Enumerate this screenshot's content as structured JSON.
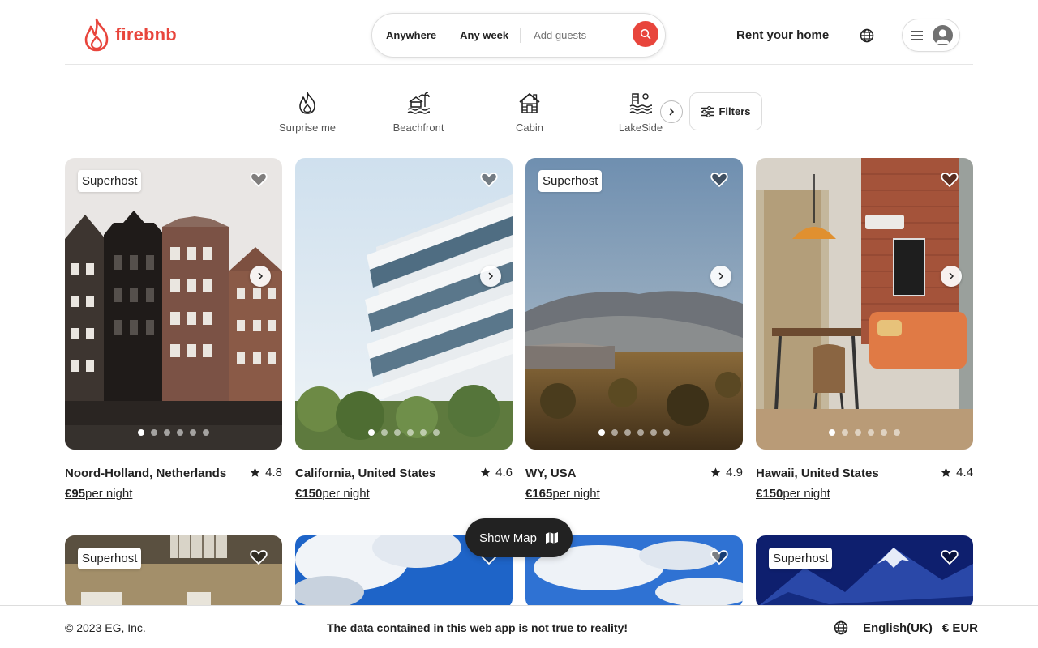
{
  "header": {
    "logo_text": "firebnb",
    "search": {
      "anywhere": "Anywhere",
      "any_week": "Any week",
      "add_guests": "Add guests"
    },
    "rent_label": "Rent your home"
  },
  "categories": [
    {
      "label": "Surprise me",
      "icon": "flame-icon"
    },
    {
      "label": "Beachfront",
      "icon": "beach-house-icon"
    },
    {
      "label": "Cabin",
      "icon": "cabin-icon"
    },
    {
      "label": "LakeSide",
      "icon": "lakeside-icon"
    }
  ],
  "filters_label": "Filters",
  "listings": [
    {
      "superhost": "Superhost",
      "location": "Noord-Holland, Netherlands",
      "rating": "4.8",
      "price": "€95",
      "per_night": "per night",
      "photo_count": 6,
      "active_photo": 0
    },
    {
      "superhost": "",
      "location": "California, United States",
      "rating": "4.6",
      "price": "€150",
      "per_night": "per night",
      "photo_count": 6,
      "active_photo": 0
    },
    {
      "superhost": "Superhost",
      "location": "WY, USA",
      "rating": "4.9",
      "price": "€165",
      "per_night": "per night",
      "photo_count": 6,
      "active_photo": 0
    },
    {
      "superhost": "",
      "location": "Hawaii, United States",
      "rating": "4.4",
      "price": "€150",
      "per_night": "per night",
      "photo_count": 6,
      "active_photo": 0
    },
    {
      "superhost": "Superhost"
    },
    {
      "superhost": ""
    },
    {
      "superhost": ""
    },
    {
      "superhost": "Superhost"
    }
  ],
  "show_map_label": "Show Map",
  "footer": {
    "copyright": "© 2023 EG, Inc.",
    "notice": "The data contained in this web app is not true to reality!",
    "language": "English(UK)",
    "currency": "€ EUR"
  },
  "colors": {
    "brand": "#e8453c",
    "text": "#222222",
    "muted": "#717171"
  }
}
